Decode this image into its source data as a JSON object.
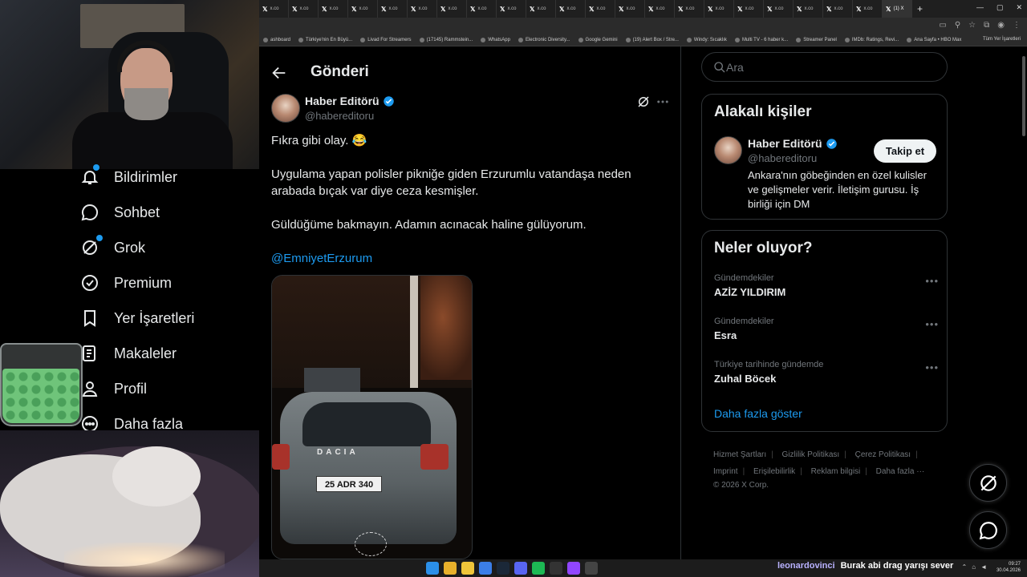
{
  "browser": {
    "tabs": [
      "x.co",
      "x.co",
      "x.co",
      "x.co",
      "x.co",
      "x.co",
      "x.co",
      "x.co",
      "x.co",
      "x.co",
      "x.co",
      "x.co",
      "x.co",
      "x.co",
      "x.co",
      "x.co",
      "x.co",
      "x.co",
      "x.co",
      "x.co",
      "x.co",
      "(1) X"
    ],
    "new_tab": "+",
    "bookmarks": [
      "ashboard",
      "Türkiye'nin En Büyü...",
      "Livad For Streamers",
      "(17145) Rammstein...",
      "WhatsApp",
      "Electronic Diversity...",
      "Google Gemini",
      "(19) Alert Box / Stre...",
      "Windy: Sıcaklık",
      "Multi TV - 6 haber k...",
      "Streamer Panel",
      "IMDb: Ratings, Revi...",
      "Ana Sayfa • HBO Max"
    ],
    "all_bookmarks": "Tüm Yer İşaretleri"
  },
  "nav": {
    "items": [
      {
        "label": "Bildirimler",
        "icon": "bell-icon"
      },
      {
        "label": "Sohbet",
        "icon": "chat-icon"
      },
      {
        "label": "Grok",
        "icon": "grok-icon"
      },
      {
        "label": "Premium",
        "icon": "premium-icon"
      },
      {
        "label": "Yer İşaretleri",
        "icon": "bookmark-icon"
      },
      {
        "label": "Makaleler",
        "icon": "article-icon"
      },
      {
        "label": "Profil",
        "icon": "profile-icon"
      },
      {
        "label": "Daha fazla",
        "icon": "more-circle-icon"
      }
    ]
  },
  "post": {
    "header_title": "Gönderi",
    "author_name": "Haber Editörü",
    "author_handle": "@habereditoru",
    "paragraphs": [
      "Fıkra gibi olay. 😂",
      "Uygulama yapan polisler pikniğe giden Erzurumlu vatandaşa neden arabada bıçak var diye ceza kesmişler.",
      "Güldüğüme bakmayın. Adamın acınacak haline gülüyorum."
    ],
    "mention": "@EmniyetErzurum",
    "media": {
      "car_brand": "DACIA",
      "plate": "25 ADR 340"
    }
  },
  "sidebar": {
    "search_placeholder": "Ara",
    "related": {
      "title": "Alakalı kişiler",
      "name": "Haber Editörü",
      "handle": "@habereditoru",
      "bio": "Ankara'nın göbeğinden en özel kulisler ve gelişmeler verir. İletişim gurusu. İş birliği için DM",
      "follow_label": "Takip et"
    },
    "trends": {
      "title": "Neler oluyor?",
      "items": [
        {
          "context": "Gündemdekiler",
          "name": "AZİZ YILDIRIM"
        },
        {
          "context": "Gündemdekiler",
          "name": "Esra"
        },
        {
          "context": "Türkiye tarihinde gündemde",
          "name": "Zuhal Böcek"
        }
      ],
      "show_more": "Daha fazla göster"
    },
    "footer": {
      "links": [
        "Hizmet Şartları",
        "Gizlilik Politikası",
        "Çerez Politikası",
        "Imprint",
        "Erişilebilirlik",
        "Reklam bilgisi",
        "Daha fazla ···"
      ],
      "copyright": "© 2026 X Corp."
    }
  },
  "taskbar": {
    "chat_user": "leonardovinci",
    "chat_message": "Burak abi drag yarışı sever",
    "time": "09:27",
    "date": "30.04.2026"
  },
  "colors": {
    "accent": "#1d9bf0",
    "text": "#e7e9ea",
    "muted": "#71767b",
    "border": "#2f3336",
    "background": "#000000"
  }
}
